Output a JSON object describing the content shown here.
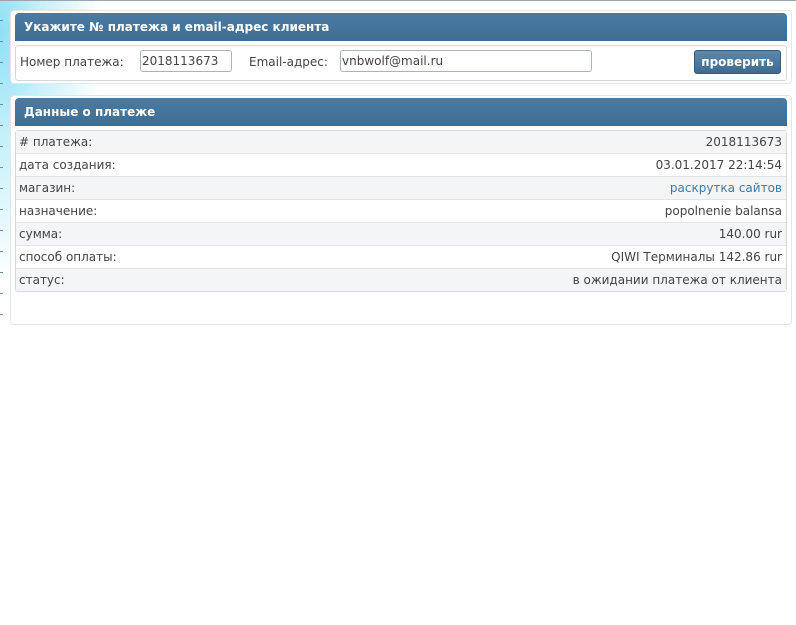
{
  "check_panel": {
    "title": "Укажите № платежа и email-адрес клиента",
    "payment_number_label": "Номер платежа:",
    "payment_number_value": "2018113673",
    "email_label": "Email-адрес:",
    "email_value": "vnbwolf@mail.ru",
    "check_button": "проверить"
  },
  "details_panel": {
    "title": "Данные о платеже",
    "rows": [
      {
        "label": "# платежа:",
        "value": "2018113673"
      },
      {
        "label": "дата создания:",
        "value": "03.01.2017 22:14:54"
      },
      {
        "label": "магазин:",
        "value": "раскрутка сайтов"
      },
      {
        "label": "назначение:",
        "value": "popolnenie balansa"
      },
      {
        "label": "сумма:",
        "value": "140.00 rur"
      },
      {
        "label": "способ оплаты:",
        "value": "QIWI Терминалы 142.86 rur"
      },
      {
        "label": "статус:",
        "value": "в ожидании платежа от клиента"
      }
    ]
  },
  "colors": {
    "header_bg": "#45749a",
    "link": "#3d79a7",
    "button_bg": "#4b7aa0"
  }
}
